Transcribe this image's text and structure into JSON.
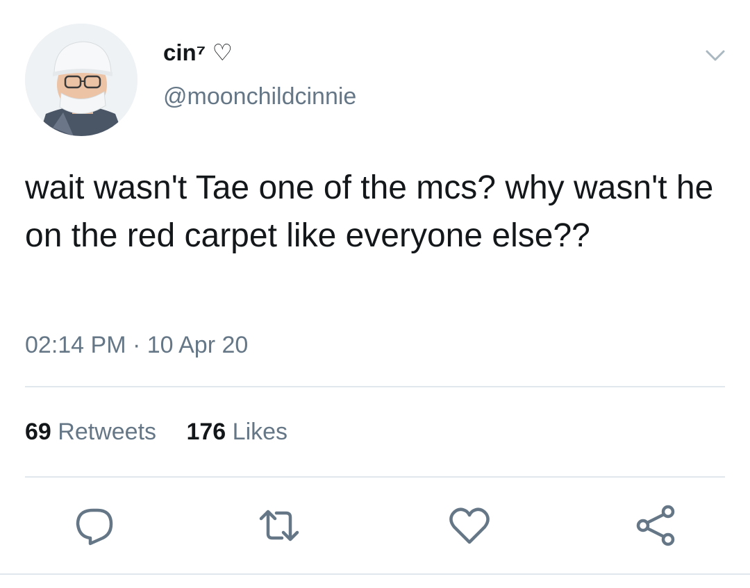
{
  "tweet": {
    "display_name": "cin⁷ ♡",
    "handle": "@moonchildcinnie",
    "text": "wait wasn't Tae one of the mcs? why wasn't he on the red carpet like everyone else??",
    "timestamp": "02:14 PM · 10 Apr 20"
  },
  "stats": {
    "retweets_count": "69",
    "retweets_label": "Retweets",
    "likes_count": "176",
    "likes_label": "Likes"
  },
  "icons": {
    "menu": "chevron-down-icon",
    "reply": "reply-icon",
    "retweet": "retweet-icon",
    "like": "heart-icon",
    "share": "share-icon"
  },
  "colors": {
    "text": "#14171a",
    "secondary": "#657786",
    "divider": "#e1e8ed"
  }
}
